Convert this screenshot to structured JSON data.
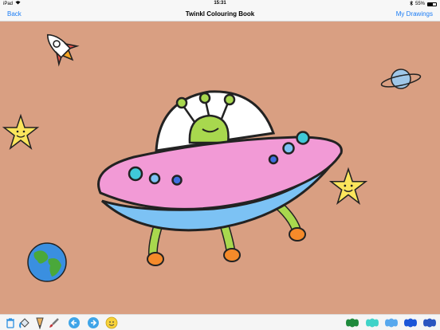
{
  "status": {
    "device": "iPad",
    "time": "15:31",
    "battery": "55%"
  },
  "nav": {
    "back_label": "Back",
    "title": "Twinkl Colouring Book",
    "right_label": "My Drawings"
  },
  "colors": {
    "canvas_bg": "#d99f82",
    "accent": "#1a7cf5",
    "ufo_body": "#f29ad6",
    "ufo_bottom": "#7cc2f4",
    "alien": "#a8d84e",
    "feet": "#f58a2a"
  },
  "toolbar": {
    "tools": [
      "trash-icon",
      "fill-bucket-icon",
      "pencil-icon",
      "brush-icon",
      "undo-icon",
      "redo-icon",
      "sticker-icon"
    ],
    "swatches": [
      "#1e8a3c",
      "#3fd3c8",
      "#57a8ee",
      "#1a55d8",
      "#2a55c0"
    ]
  }
}
